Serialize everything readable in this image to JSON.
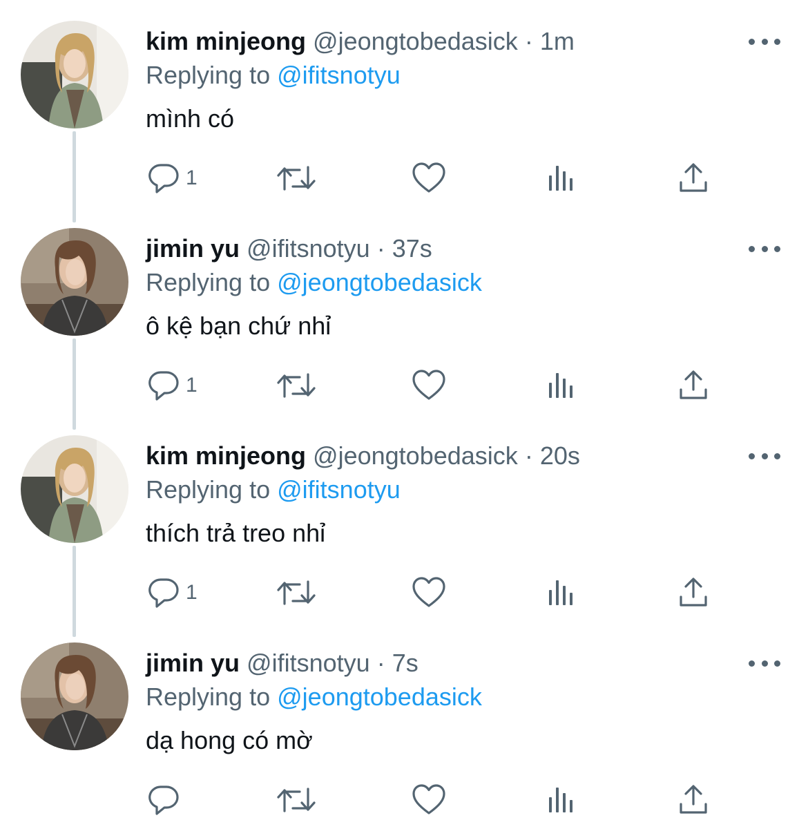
{
  "colors": {
    "text": "#0f1419",
    "secondary": "#536471",
    "link": "#1d9bf0",
    "thread_line": "#cfd9de"
  },
  "replying_prefix": "Replying to",
  "tweets": [
    {
      "name": "kim minjeong",
      "handle": "@jeongtobedasick",
      "time": "1m",
      "replying_to": "@ifitsnotyu",
      "text": "mình có",
      "reply_count": "1",
      "avatar": "kim"
    },
    {
      "name": "jimin yu",
      "handle": "@ifitsnotyu",
      "time": "37s",
      "replying_to": "@jeongtobedasick",
      "text": "ô kệ bạn chứ nhỉ",
      "reply_count": "1",
      "avatar": "jimin"
    },
    {
      "name": "kim minjeong",
      "handle": "@jeongtobedasick",
      "time": "20s",
      "replying_to": "@ifitsnotyu",
      "text": "thích trả treo nhỉ",
      "reply_count": "1",
      "avatar": "kim"
    },
    {
      "name": "jimin yu",
      "handle": "@ifitsnotyu",
      "time": "7s",
      "replying_to": "@jeongtobedasick",
      "text": "dạ hong có mờ",
      "reply_count": "",
      "avatar": "jimin"
    }
  ],
  "icons": {
    "reply": "reply-icon",
    "retweet": "retweet-icon",
    "like": "heart-icon",
    "views": "analytics-icon",
    "share": "share-icon",
    "more": "more-icon"
  }
}
